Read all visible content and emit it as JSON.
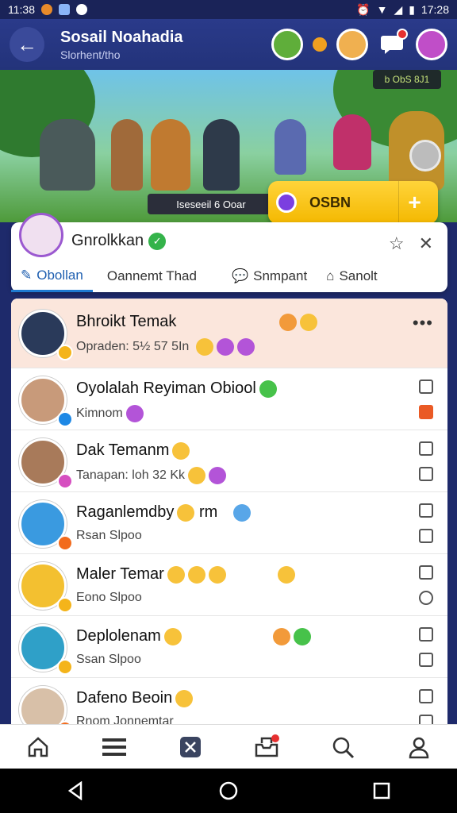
{
  "status_bar": {
    "time_left": "11:38",
    "time_right": "17:28"
  },
  "app_bar": {
    "title": "Sosail Noahadia",
    "subtitle": "Slorhent/tho"
  },
  "banner": {
    "tag": "b ObS 8J1",
    "label": "Iseseeil 6  Ooar",
    "cta_label": "OSBN",
    "cta_plus": "+"
  },
  "profile_card": {
    "name": "Gnrolkkan",
    "tabs": [
      {
        "label": "Obollan"
      },
      {
        "label": "Oannemt Thad"
      },
      {
        "label": "Snmpant"
      },
      {
        "label": "Sanolt"
      }
    ]
  },
  "list": {
    "rows": [
      {
        "name": "Bhroikt Temak",
        "sub": "Opraden: 5½ 57 5In",
        "badge_color": "#f4b41a"
      },
      {
        "name": "Oyolalah Reyiman Obiool",
        "sub": "Kimnom",
        "badge_color": "#1e88e5"
      },
      {
        "name": "Dak Temanm",
        "sub": "Tanapan: loh 32 Kk",
        "badge_color": "#d64fc0"
      },
      {
        "name": "Raganlemdby",
        "name_suffix": "rm",
        "sub": "Rsan Slpoo",
        "badge_color": "#f26b1d"
      },
      {
        "name": "Maler Temar",
        "sub": "Eono Slpoo",
        "badge_color": "#f4b41a"
      },
      {
        "name": "Deplolenam",
        "sub": "Ssan Slpoo",
        "badge_color": "#f4b41a"
      },
      {
        "name": "Dafeno Beoin",
        "sub": "Rnom Jonnemtar",
        "badge_color": "#f26b1d"
      }
    ]
  },
  "colors": {
    "accent": "#1f7ad0",
    "header": "#2a3a8a",
    "cta": "#f4b800"
  }
}
